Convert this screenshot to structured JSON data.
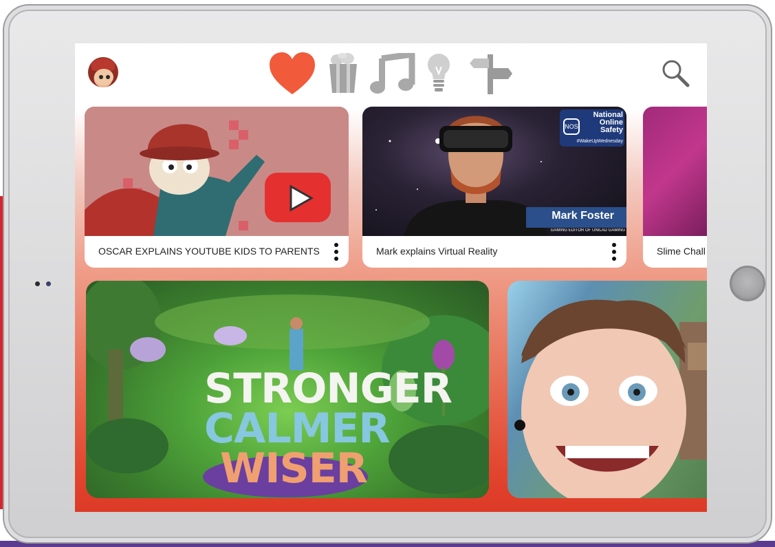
{
  "colors": {
    "accent_heart": "#f15a3a",
    "icon_gray": "#9a9a9a",
    "screen_gradient_bottom": "#dc3a26"
  },
  "nav": {
    "icons": [
      "heart-icon",
      "popcorn-icon",
      "music-icon",
      "lightbulb-icon",
      "signpost-icon",
      "search-icon"
    ]
  },
  "cards": [
    {
      "title": "OSCAR EXPLAINS YOUTUBE KIDS TO PARENTS"
    },
    {
      "title": "Mark explains Virtual Reality",
      "thumb_text": {
        "brand": "National Online Safety",
        "logo": "NOS",
        "tag": "#WakeUpWednesday",
        "name": "Mark Foster",
        "role": "GAMING EDITOR OF UNILAD GAMING"
      }
    },
    {
      "title": "Slime Chall"
    }
  ],
  "featured": {
    "line1": "STRONGER",
    "line2": "CALMER",
    "line3": "WISER"
  }
}
